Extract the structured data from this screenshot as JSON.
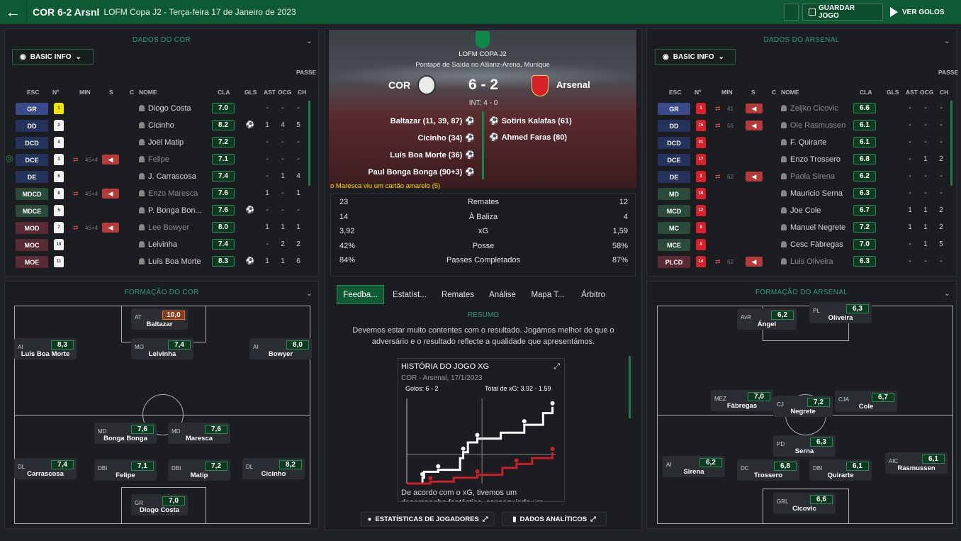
{
  "header": {
    "title": "COR 6-2 Arsnl",
    "competition": "LOFM Copa J2 - Terça-feira 17 de Janeiro de 2023",
    "save_label": "GUARDAR JOGO",
    "goals_label": "VER GOLOS"
  },
  "left": {
    "title": "DADOS DO COR",
    "basic_info": "BASIC INFO",
    "formation_title": "FORMAÇÃO DO COR"
  },
  "right": {
    "title": "DADOS DO ARSENAL",
    "basic_info": "BASIC INFO",
    "formation_title": "FORMAÇÃO DO ARSENAL"
  },
  "table_headers": {
    "esc": "ESC",
    "num": "Nº",
    "min": "MIN",
    "s": "S",
    "c": "C",
    "nome": "NOME",
    "cla": "CLA",
    "gls": "GLS",
    "ast": "AST",
    "passe": "PASSE",
    "ocg": "OCG",
    "ch": "CH"
  },
  "cor_players": [
    {
      "pos": "GR",
      "num": "1",
      "name": "Diogo Costa",
      "cla": "7.0",
      "gls": "",
      "ast": "-",
      "ocg": "-",
      "ch": "-",
      "subin": "",
      "sub": false,
      "dim": false,
      "ball": false
    },
    {
      "pos": "DD",
      "num": "2",
      "name": "Cicinho",
      "cla": "8.2",
      "gls": "⚽",
      "ast": "1",
      "ocg": "4",
      "ch": "5",
      "subin": "",
      "sub": false,
      "dim": false,
      "ball": false
    },
    {
      "pos": "DCD",
      "num": "4",
      "name": "Joël Matip",
      "cla": "7.2",
      "gls": "",
      "ast": "-",
      "ocg": "-",
      "ch": "-",
      "subin": "",
      "sub": false,
      "dim": false,
      "ball": false
    },
    {
      "pos": "DCE",
      "num": "3",
      "name": "Felipe",
      "cla": "7.1",
      "gls": "",
      "ast": "-",
      "ocg": "-",
      "ch": "-",
      "subin": "45+4",
      "sub": true,
      "dim": true,
      "ball": true
    },
    {
      "pos": "DE",
      "num": "6",
      "name": "J. Carrascosa",
      "cla": "7.4",
      "gls": "",
      "ast": "-",
      "ocg": "1",
      "ch": "4",
      "subin": "",
      "sub": false,
      "dim": false,
      "ball": false
    },
    {
      "pos": "MDCD",
      "num": "8",
      "name": "Enzo Maresca",
      "cla": "7.6",
      "gls": "",
      "ast": "1",
      "ocg": "-",
      "ch": "1",
      "subin": "45+4",
      "sub": true,
      "dim": true,
      "ball": false
    },
    {
      "pos": "MDCE",
      "num": "5",
      "name": "P. Bonga Bon...",
      "cla": "7.6",
      "gls": "⚽",
      "ast": "-",
      "ocg": "-",
      "ch": "-",
      "subin": "",
      "sub": false,
      "dim": false,
      "ball": false
    },
    {
      "pos": "MOD",
      "num": "7",
      "name": "Lee Bowyer",
      "cla": "8.0",
      "gls": "",
      "ast": "1",
      "ocg": "1",
      "ch": "1",
      "subin": "45+4",
      "sub": true,
      "dim": true,
      "ball": false
    },
    {
      "pos": "MOC",
      "num": "10",
      "name": "Leivinha",
      "cla": "7.4",
      "gls": "",
      "ast": "-",
      "ocg": "2",
      "ch": "2",
      "subin": "",
      "sub": false,
      "dim": false,
      "ball": false
    },
    {
      "pos": "MOE",
      "num": "11",
      "name": "Luís Boa Morte",
      "cla": "8.3",
      "gls": "⚽",
      "ast": "1",
      "ocg": "1",
      "ch": "6",
      "subin": "",
      "sub": false,
      "dim": false,
      "ball": false
    }
  ],
  "ars_players": [
    {
      "pos": "GR",
      "num": "1",
      "name": "Zeljko Cicovic",
      "cla": "6.6",
      "ast": "-",
      "ocg": "-",
      "ch": "-",
      "subin": "41",
      "sub": true,
      "dim": true
    },
    {
      "pos": "DD",
      "num": "15",
      "name": "Ole Rasmussen",
      "cla": "6.1",
      "ast": "-",
      "ocg": "-",
      "ch": "-",
      "subin": "56",
      "sub": true,
      "dim": true
    },
    {
      "pos": "DCD",
      "num": "21",
      "name": "F. Quirarte",
      "cla": "6.1",
      "ast": "-",
      "ocg": "-",
      "ch": "-",
      "subin": "",
      "sub": false,
      "dim": false
    },
    {
      "pos": "DCE",
      "num": "17",
      "name": "Enzo Trossero",
      "cla": "6.8",
      "ast": "-",
      "ocg": "1",
      "ch": "2",
      "subin": "",
      "sub": false,
      "dim": false
    },
    {
      "pos": "DE",
      "num": "3",
      "name": "Paola Sirena",
      "cla": "6.2",
      "ast": "-",
      "ocg": "-",
      "ch": "-",
      "subin": "52",
      "sub": true,
      "dim": true
    },
    {
      "pos": "MD",
      "num": "16",
      "name": "Mauricio Serna",
      "cla": "6.3",
      "ast": "-",
      "ocg": "-",
      "ch": "-",
      "subin": "",
      "sub": false,
      "dim": false
    },
    {
      "pos": "MCD",
      "num": "12",
      "name": "Joe Cole",
      "cla": "6.7",
      "ast": "1",
      "ocg": "1",
      "ch": "2",
      "subin": "",
      "sub": false,
      "dim": false
    },
    {
      "pos": "MC",
      "num": "8",
      "name": "Manuel Negrete",
      "cla": "7.2",
      "ast": "1",
      "ocg": "1",
      "ch": "2",
      "subin": "",
      "sub": false,
      "dim": false
    },
    {
      "pos": "MCE",
      "num": "4",
      "name": "Cesc Fàbregas",
      "cla": "7.0",
      "ast": "-",
      "ocg": "1",
      "ch": "5",
      "subin": "",
      "sub": false,
      "dim": false
    },
    {
      "pos": "PLCD",
      "num": "14",
      "name": "Luis Oliveira",
      "cla": "6.3",
      "ast": "-",
      "ocg": "-",
      "ch": "-",
      "subin": "52",
      "sub": true,
      "dim": true
    }
  ],
  "match": {
    "competition": "LOFM COPA J2",
    "kickoff": "Pontapé de Saída no Allianz-Arena, Munique",
    "home": "COR",
    "away": "Arsenal",
    "score": "6 - 2",
    "ht": "INT: 4 - 0",
    "home_scorers": [
      "Baltazar (11, 39, 87)",
      "Cicinho (34)",
      "Luís Boa Morte (36)",
      "Paul Bonga Bonga (90+3)"
    ],
    "away_scorers": [
      "Sotiris Kalafas (61)",
      "Ahmed Faras (80)"
    ],
    "event": "o Maresca viu um cartão amarelo (5)"
  },
  "stats": [
    {
      "h": "23",
      "label": "Remates",
      "a": "12"
    },
    {
      "h": "14",
      "label": "À Baliza",
      "a": "4"
    },
    {
      "h": "3,92",
      "label": "xG",
      "a": "1,59"
    },
    {
      "h": "42%",
      "label": "Posse",
      "a": "58%"
    },
    {
      "h": "84%",
      "label": "Passes Completados",
      "a": "87%"
    }
  ],
  "tabs": [
    "Feedba...",
    "Estatíst...",
    "Remates",
    "Análise",
    "Mapa T...",
    "Árbitro"
  ],
  "summary": {
    "title": "RESUMO",
    "text": "Devemos estar muito contentes com o resultado. Jogámos melhor do que o adversário e o resultado reflecte a qualidade que apresentámos."
  },
  "xg_card": {
    "title": "HISTÓRIA DO JOGO XG",
    "subtitle": "COR - Arsenal, 17/1/2023",
    "goals": "Golos: 6 - 2",
    "xg_total": "Total de xG: 3.92 - 1.59",
    "text": "De acordo com o xG, tivemos um desempenho fantástico, conseguindo um"
  },
  "chart_data": {
    "type": "line",
    "series": [
      {
        "values": [
          [
            0,
            0
          ],
          [
            10,
            0.3
          ],
          [
            11,
            0.6
          ],
          [
            20,
            0.7
          ],
          [
            34,
            1.3
          ],
          [
            36,
            1.6
          ],
          [
            39,
            2.1
          ],
          [
            45,
            2.3
          ],
          [
            60,
            2.6
          ],
          [
            75,
            3.0
          ],
          [
            87,
            3.6
          ],
          [
            93,
            3.92
          ]
        ]
      },
      {
        "values": [
          [
            0,
            0
          ],
          [
            15,
            0.1
          ],
          [
            30,
            0.3
          ],
          [
            45,
            0.45
          ],
          [
            61,
            0.8
          ],
          [
            70,
            1.0
          ],
          [
            80,
            1.3
          ],
          [
            93,
            1.59
          ]
        ]
      }
    ]
  },
  "bottom": {
    "player_stats": "ESTATÍSTICAS DE JOGADORES",
    "analytics": "DADOS ANALÍTICOS"
  },
  "cor_formation": [
    {
      "pos": "AT",
      "rating": "10,0",
      "name": "Baltazar",
      "hot": true
    },
    {
      "pos": "AI",
      "rating": "8,3",
      "name": "Luís Boa Morte"
    },
    {
      "pos": "MO",
      "rating": "7,4",
      "name": "Leivinha"
    },
    {
      "pos": "AI",
      "rating": "8,0",
      "name": "Bowyer"
    },
    {
      "pos": "MD",
      "rating": "7,6",
      "name": "Bonga Bonga"
    },
    {
      "pos": "MD",
      "rating": "7,6",
      "name": "Maresca"
    },
    {
      "pos": "DL",
      "rating": "7,4",
      "name": "Carrascosa"
    },
    {
      "pos": "DBI",
      "rating": "7,1",
      "name": "Felipe"
    },
    {
      "pos": "DBI",
      "rating": "7,2",
      "name": "Matip"
    },
    {
      "pos": "DL",
      "rating": "8,2",
      "name": "Cicinho"
    },
    {
      "pos": "GR",
      "rating": "7,0",
      "name": "Diogo Costa"
    }
  ],
  "ars_formation": [
    {
      "pos": "AvR",
      "rating": "6,2",
      "name": "Ángel"
    },
    {
      "pos": "PL",
      "rating": "6,3",
      "name": "Oliveira"
    },
    {
      "pos": "MEZ",
      "rating": "7,0",
      "name": "Fàbregas"
    },
    {
      "pos": "CJ",
      "rating": "7,2",
      "name": "Negrete"
    },
    {
      "pos": "CJA",
      "rating": "6,7",
      "name": "Cole"
    },
    {
      "pos": "PD",
      "rating": "6,3",
      "name": "Serna"
    },
    {
      "pos": "AI",
      "rating": "6,2",
      "name": "Sirena"
    },
    {
      "pos": "DC",
      "rating": "6,8",
      "name": "Trossero"
    },
    {
      "pos": "DBI",
      "rating": "6,1",
      "name": "Quirarte"
    },
    {
      "pos": "AIC",
      "rating": "6,1",
      "name": "Rasmussen"
    },
    {
      "pos": "GRL",
      "rating": "6,6",
      "name": "Cicovic"
    }
  ]
}
